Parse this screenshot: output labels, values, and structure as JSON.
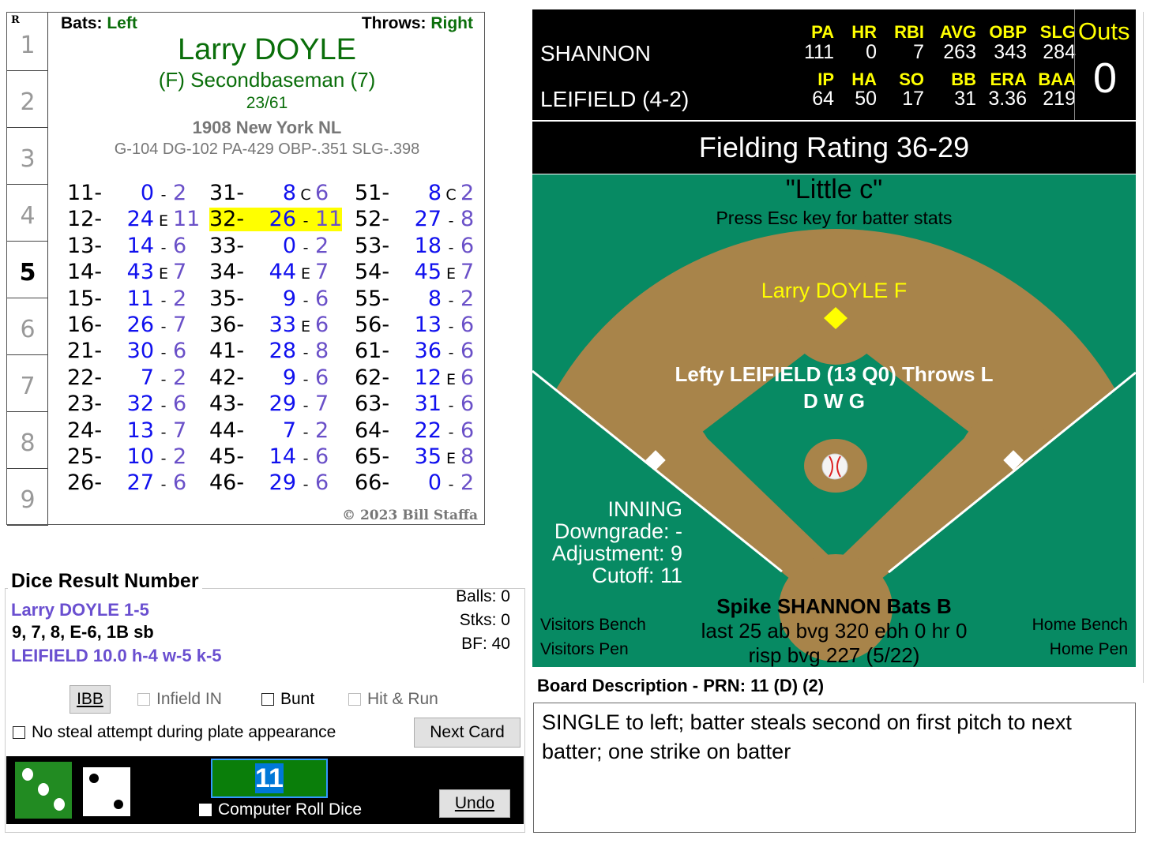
{
  "card": {
    "row_header": "R",
    "row_numbers": [
      "1",
      "2",
      "3",
      "4",
      "5",
      "6",
      "7",
      "8",
      "9"
    ],
    "current_row": "5",
    "bats_label": "Bats:",
    "bats": "Left",
    "throws_label": "Throws:",
    "throws": "Right",
    "player_name": "Larry DOYLE",
    "position": "(F) Secondbaseman (7)",
    "ratio": "23/61",
    "team": "1908 New York NL",
    "stats": "G-104 DG-102 PA-429 OBP-.351 SLG-.398",
    "copyright": "© 2023 Bill Staffa",
    "highlight_roll": "32-",
    "columns": [
      [
        {
          "roll": "11-",
          "num": "0",
          "sep": "-",
          "sub": "2"
        },
        {
          "roll": "12-",
          "num": "24",
          "sep": "E",
          "sub": "11"
        },
        {
          "roll": "13-",
          "num": "14",
          "sep": "-",
          "sub": "6"
        },
        {
          "roll": "14-",
          "num": "43",
          "sep": "E",
          "sub": "7"
        },
        {
          "roll": "15-",
          "num": "11",
          "sep": "-",
          "sub": "2"
        },
        {
          "roll": "16-",
          "num": "26",
          "sep": "-",
          "sub": "7"
        },
        {
          "roll": "21-",
          "num": "30",
          "sep": "-",
          "sub": "6"
        },
        {
          "roll": "22-",
          "num": "7",
          "sep": "-",
          "sub": "2"
        },
        {
          "roll": "23-",
          "num": "32",
          "sep": "-",
          "sub": "6"
        },
        {
          "roll": "24-",
          "num": "13",
          "sep": "-",
          "sub": "7"
        },
        {
          "roll": "25-",
          "num": "10",
          "sep": "-",
          "sub": "2"
        },
        {
          "roll": "26-",
          "num": "27",
          "sep": "-",
          "sub": "6"
        }
      ],
      [
        {
          "roll": "31-",
          "num": "8",
          "sep": "C",
          "sub": "6"
        },
        {
          "roll": "32-",
          "num": "26",
          "sep": "-",
          "sub": "11"
        },
        {
          "roll": "33-",
          "num": "0",
          "sep": "-",
          "sub": "2"
        },
        {
          "roll": "34-",
          "num": "44",
          "sep": "E",
          "sub": "7"
        },
        {
          "roll": "35-",
          "num": "9",
          "sep": "-",
          "sub": "6"
        },
        {
          "roll": "36-",
          "num": "33",
          "sep": "E",
          "sub": "6"
        },
        {
          "roll": "41-",
          "num": "28",
          "sep": "-",
          "sub": "8"
        },
        {
          "roll": "42-",
          "num": "9",
          "sep": "-",
          "sub": "6"
        },
        {
          "roll": "43-",
          "num": "29",
          "sep": "-",
          "sub": "7"
        },
        {
          "roll": "44-",
          "num": "7",
          "sep": "-",
          "sub": "2"
        },
        {
          "roll": "45-",
          "num": "14",
          "sep": "-",
          "sub": "6"
        },
        {
          "roll": "46-",
          "num": "29",
          "sep": "-",
          "sub": "6"
        }
      ],
      [
        {
          "roll": "51-",
          "num": "8",
          "sep": "C",
          "sub": "2"
        },
        {
          "roll": "52-",
          "num": "27",
          "sep": "-",
          "sub": "8"
        },
        {
          "roll": "53-",
          "num": "18",
          "sep": "-",
          "sub": "6"
        },
        {
          "roll": "54-",
          "num": "45",
          "sep": "E",
          "sub": "7"
        },
        {
          "roll": "55-",
          "num": "8",
          "sep": "-",
          "sub": "2"
        },
        {
          "roll": "56-",
          "num": "13",
          "sep": "-",
          "sub": "6"
        },
        {
          "roll": "61-",
          "num": "36",
          "sep": "-",
          "sub": "6"
        },
        {
          "roll": "62-",
          "num": "12",
          "sep": "E",
          "sub": "6"
        },
        {
          "roll": "63-",
          "num": "31",
          "sep": "-",
          "sub": "6"
        },
        {
          "roll": "64-",
          "num": "22",
          "sep": "-",
          "sub": "6"
        },
        {
          "roll": "65-",
          "num": "35",
          "sep": "E",
          "sub": "8"
        },
        {
          "roll": "66-",
          "num": "0",
          "sep": "-",
          "sub": "2"
        }
      ]
    ]
  },
  "dice_panel": {
    "title": "Dice Result Number",
    "batter_line": "Larry DOYLE  1-5",
    "result_line": "9, 7, 8, E-6, 1B sb",
    "pitcher_line": "LEIFIELD  10.0  h-4  w-5  k-5",
    "balls": "Balls: 0",
    "strikes": "Stks: 0",
    "bf": "BF: 40",
    "ibb_label": "IBB",
    "infield_in_label": "Infield IN",
    "bunt_label": "Bunt",
    "hit_run_label": "Hit & Run",
    "no_steal_label": "No steal attempt during plate appearance",
    "next_card_label": "Next Card",
    "dice_value": "11",
    "die1": 3,
    "die2": 2,
    "computer_roll_label": "Computer Roll Dice",
    "undo_label": "Undo"
  },
  "scoreboard": {
    "batter": "SHANNON",
    "batter_headers": [
      "PA",
      "HR",
      "RBI",
      "AVG",
      "OBP",
      "SLG"
    ],
    "batter_values": [
      "111",
      "0",
      "7",
      "263",
      "343",
      "284"
    ],
    "pitcher": "LEIFIELD (4-2)",
    "pitcher_headers": [
      "IP",
      "HA",
      "SO",
      "BB",
      "ERA",
      "BAA"
    ],
    "pitcher_values": [
      "64",
      "50",
      "17",
      "31",
      "3.36",
      "219"
    ],
    "outs_label": "Outs",
    "outs": "0"
  },
  "fielding_rating": "Fielding Rating 36-29",
  "field": {
    "title": "\"Little c\"",
    "hint": "Press Esc key for batter stats",
    "fielder": "Larry DOYLE  F",
    "pitcher_line": "Lefty LEIFIELD (13 Q0) Throws L",
    "pitcher_codes": "D W G",
    "inning": "INNING",
    "downgrade": "Downgrade: -",
    "adjustment": "Adjustment: 9",
    "cutoff": "Cutoff: 11",
    "batter_line": "Spike SHANNON Bats B",
    "batter_last25": "last 25 ab bvg 320 ebh 0 hr 0",
    "batter_risp": "risp bvg 227 (5/22)",
    "visitors_bench": "Visitors Bench",
    "visitors_pen": "Visitors Pen",
    "home_bench": "Home Bench",
    "home_pen": "Home Pen",
    "colors": {
      "grass": "#078a63",
      "dirt": "#a8844a",
      "fielder_marker": "#ffff00"
    }
  },
  "board": {
    "label": "Board Description - PRN: 11 (D) (2)",
    "text": "SINGLE to left; batter steals second on first pitch to next batter; one strike on batter"
  }
}
